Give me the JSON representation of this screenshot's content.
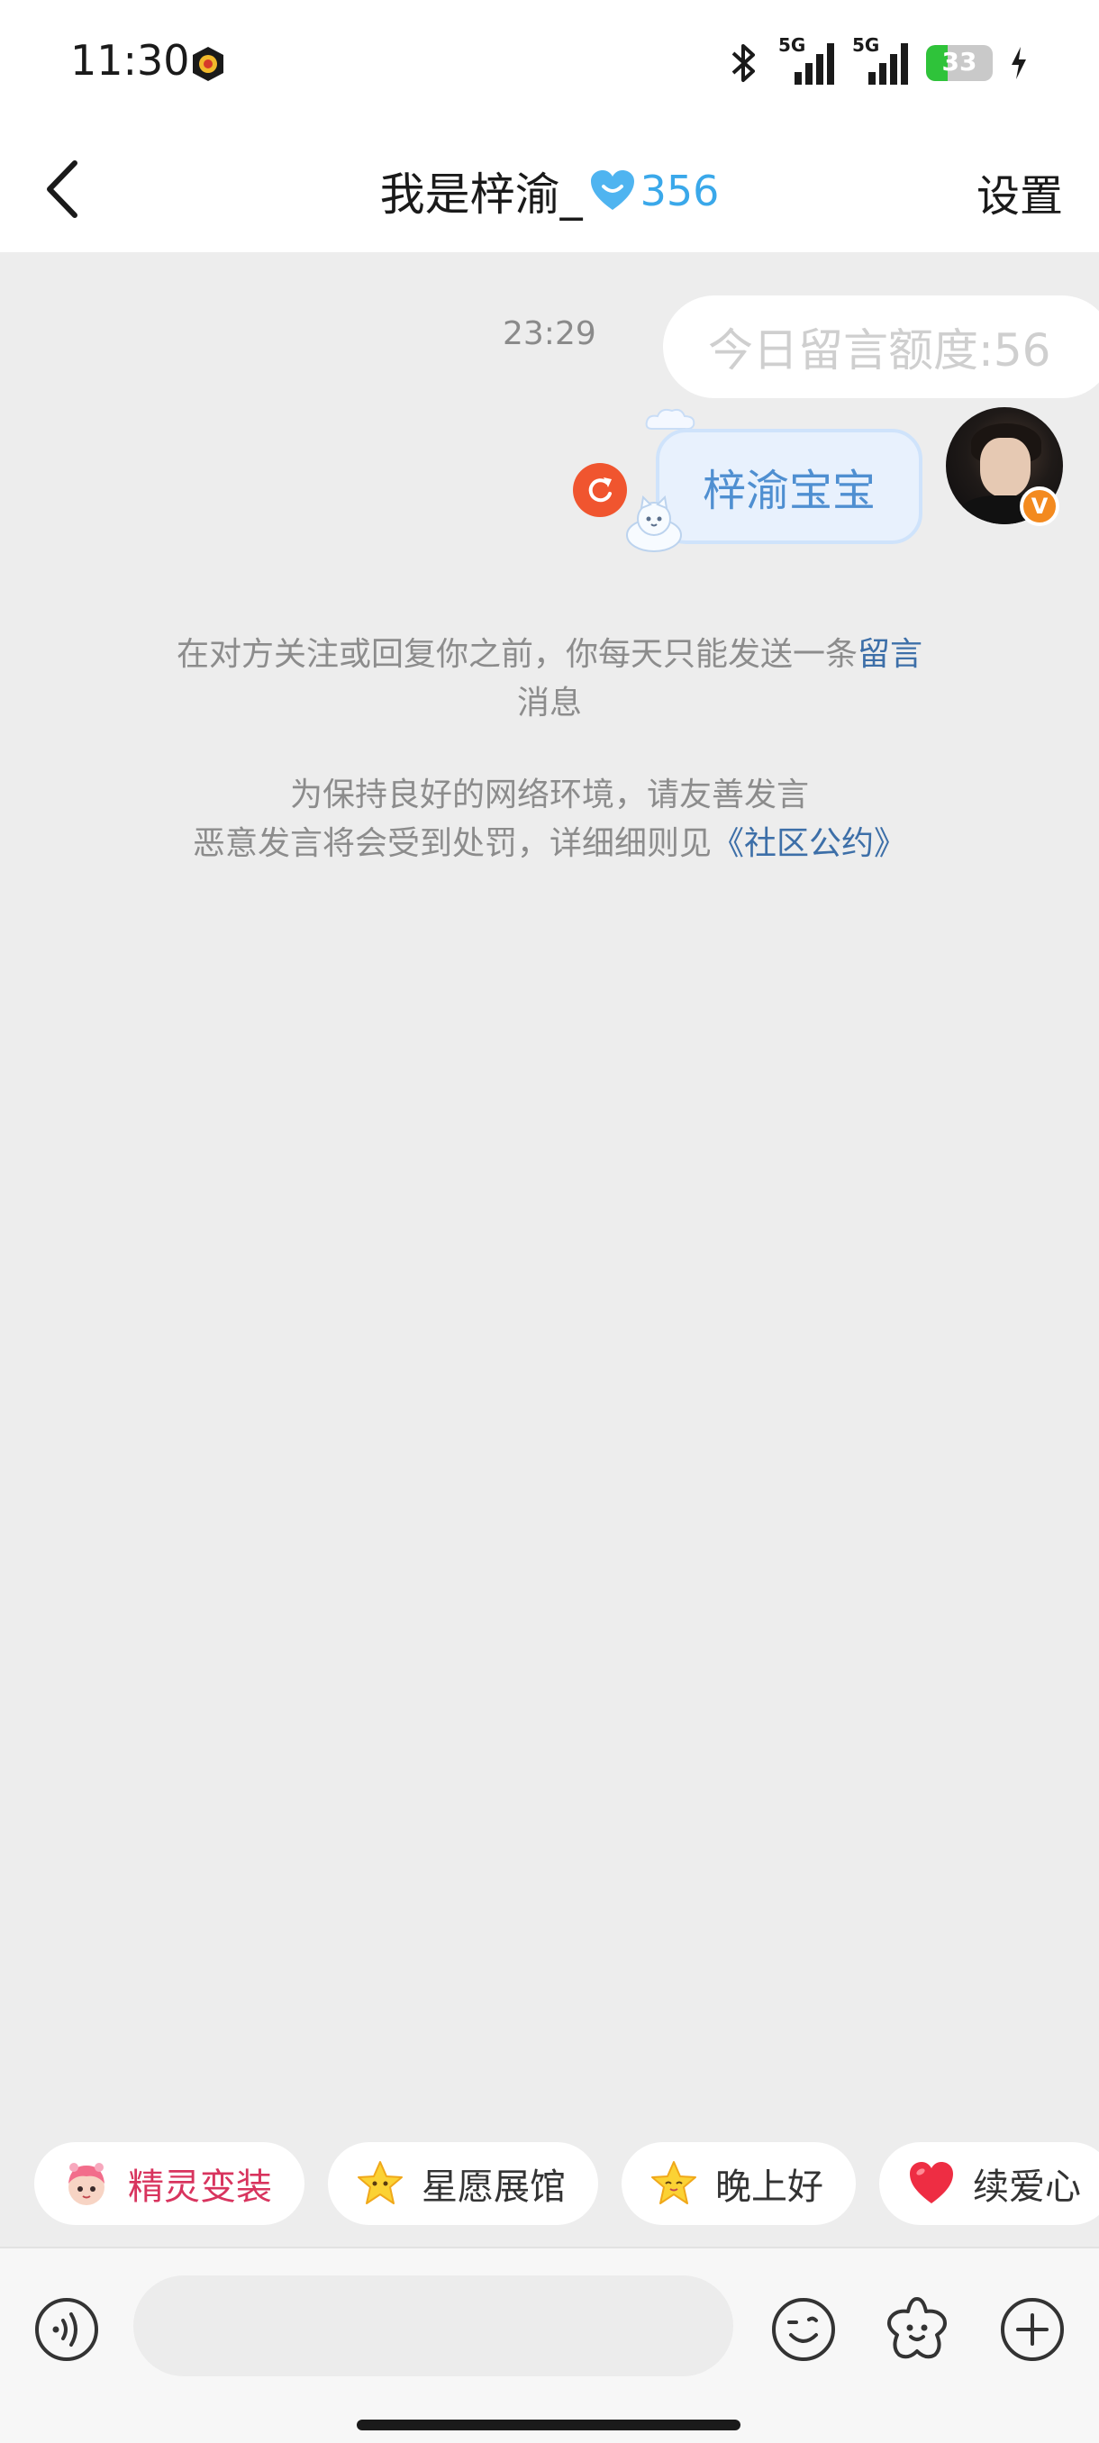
{
  "status_bar": {
    "time": "11:30",
    "network_1": "5G",
    "network_2": "5G",
    "battery_level": "33",
    "battery_fraction": 0.33,
    "battery_color": "#2fc33a"
  },
  "nav": {
    "title": "我是梓渝_",
    "heart_count": "356",
    "heart_color": "#3aa8ea",
    "settings_label": "设置"
  },
  "chat": {
    "timestamp": "23:29",
    "quota_text": "今日留言额度:56",
    "message_text": "梓渝宝宝",
    "resend_icon": "refresh-icon",
    "avatar_badge": "V"
  },
  "notices": {
    "line1_prefix": "在对方关注或回复你之前，你每天只能发送一条",
    "line1_link": "留言",
    "line1_suffix": "消息",
    "line2": "为保持良好的网络环境，请友善发言",
    "line3_prefix": "恶意发言将会受到处罚，详细细则见",
    "line3_link": "《社区公约》",
    "link_color": "#3d6fa8"
  },
  "chips": [
    {
      "label": "精灵变装",
      "icon": "sprite-icon"
    },
    {
      "label": "星愿展馆",
      "icon": "star-icon"
    },
    {
      "label": "晚上好",
      "icon": "star-face-icon"
    },
    {
      "label": "续爱心",
      "icon": "heart-icon"
    }
  ],
  "input": {
    "value": "",
    "voice_icon": "voice-icon",
    "emoji_icon": "emoji-icon",
    "sticker_icon": "sticker-icon",
    "add_icon": "plus-icon"
  }
}
